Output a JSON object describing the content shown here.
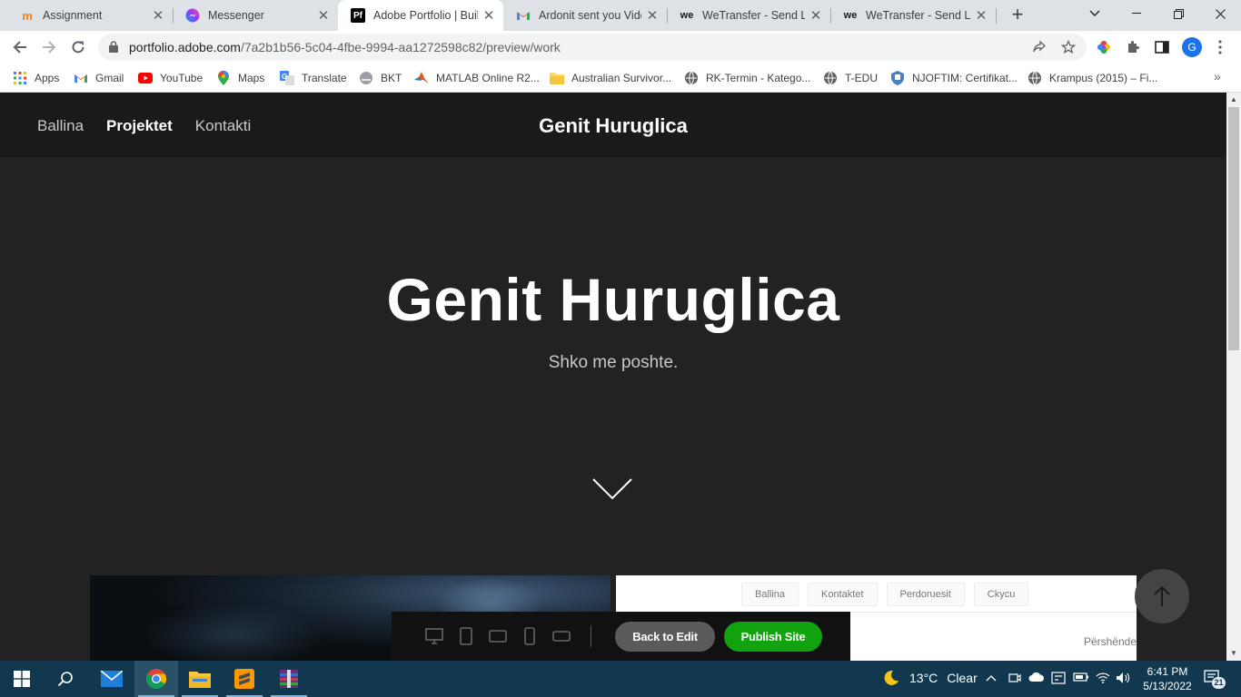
{
  "browser": {
    "tabs": [
      {
        "label": "Assignment",
        "favicon": "moodle-icon"
      },
      {
        "label": "Messenger",
        "favicon": "messenger-icon"
      },
      {
        "label": "Adobe Portfolio | Build",
        "favicon": "adobe-portfolio-icon",
        "favicon_text": "Pf"
      },
      {
        "label": "Ardonit sent you Video",
        "favicon": "gmail-icon"
      },
      {
        "label": "WeTransfer - Send Large",
        "favicon": "wetransfer-icon",
        "favicon_text": "we"
      },
      {
        "label": "WeTransfer - Send Large",
        "favicon": "wetransfer-icon",
        "favicon_text": "we"
      }
    ],
    "active_tab_index": 2,
    "url_host": "portfolio.adobe.com",
    "url_path": "/7a2b1b56-5c04-4fbe-9994-aa1272598c82/preview/work",
    "profile_initial": "G",
    "bookmarks": [
      {
        "label": "Apps",
        "icon": "apps-grid-icon"
      },
      {
        "label": "Gmail",
        "icon": "gmail-icon"
      },
      {
        "label": "YouTube",
        "icon": "youtube-icon"
      },
      {
        "label": "Maps",
        "icon": "maps-icon"
      },
      {
        "label": "Translate",
        "icon": "translate-icon"
      },
      {
        "label": "BKT",
        "icon": "bkt-icon"
      },
      {
        "label": "MATLAB Online R2...",
        "icon": "matlab-icon"
      },
      {
        "label": "Australian Survivor...",
        "icon": "folder-icon"
      },
      {
        "label": "RK-Termin - Katego...",
        "icon": "globe-icon"
      },
      {
        "label": "T-EDU",
        "icon": "globe-icon"
      },
      {
        "label": "NJOFTIM: Certifikat...",
        "icon": "shield-icon"
      },
      {
        "label": "Krampus (2015) – Fi...",
        "icon": "globe-icon"
      }
    ]
  },
  "site": {
    "nav": [
      {
        "label": "Ballina",
        "current": false
      },
      {
        "label": "Projektet",
        "current": true
      },
      {
        "label": "Kontakti",
        "current": false
      }
    ],
    "brand": "Genit Huruglica",
    "hero_title": "Genit Huruglica",
    "hero_subtitle": "Shko me poshte.",
    "project2_nav": [
      "Ballina",
      "Kontaktet",
      "Perdoruesit",
      "Ckycu"
    ],
    "project2_greeting": "Përshënde"
  },
  "preview_bar": {
    "devices": [
      "desktop-icon",
      "tablet-portrait-icon",
      "tablet-landscape-icon",
      "phone-portrait-icon",
      "phone-landscape-icon"
    ],
    "back_label": "Back to Edit",
    "publish_label": "Publish Site",
    "publish_color": "#12a10f"
  },
  "taskbar": {
    "apps": [
      "mail-icon",
      "chrome-icon",
      "file-explorer-icon",
      "sublime-text-icon",
      "winrar-icon"
    ],
    "active_app": "chrome-icon",
    "weather_temp": "13°C",
    "weather_text": "Clear",
    "time": "6:41 PM",
    "date": "5/13/2022",
    "notification_count": "21"
  }
}
